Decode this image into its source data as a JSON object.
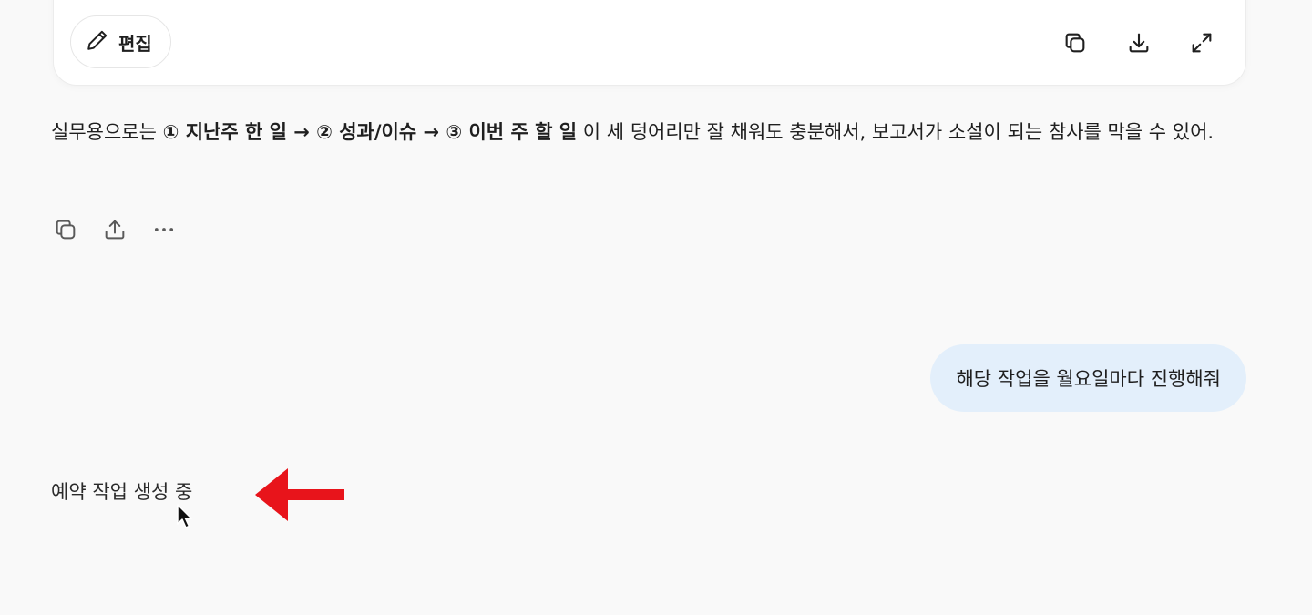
{
  "doc_toolbar": {
    "edit_label": "편집",
    "icons": [
      "copy-icon",
      "download-icon",
      "expand-icon"
    ]
  },
  "assistant_message": {
    "parts": [
      {
        "text": "실무용으로는 ",
        "bold": false
      },
      {
        "text": "① 지난주 한 일 → ② 성과/이슈 → ③ 이번 주 할 일",
        "bold": true
      },
      {
        "text": " 이 세 덩어리만 잘 채워도 충분해서, 보고서가 소설이 되는 참사를 막을 수 있어.",
        "bold": false
      }
    ],
    "actions": [
      "copy-icon",
      "share-icon",
      "more-icon"
    ]
  },
  "user_message": {
    "text": "해당 작업을 월요일마다 진행해줘"
  },
  "status": {
    "text": "예약 작업 생성 중"
  },
  "colors": {
    "background": "#f9f9f9",
    "user_bubble": "#e3effb",
    "annotation_arrow": "#e8141b"
  }
}
